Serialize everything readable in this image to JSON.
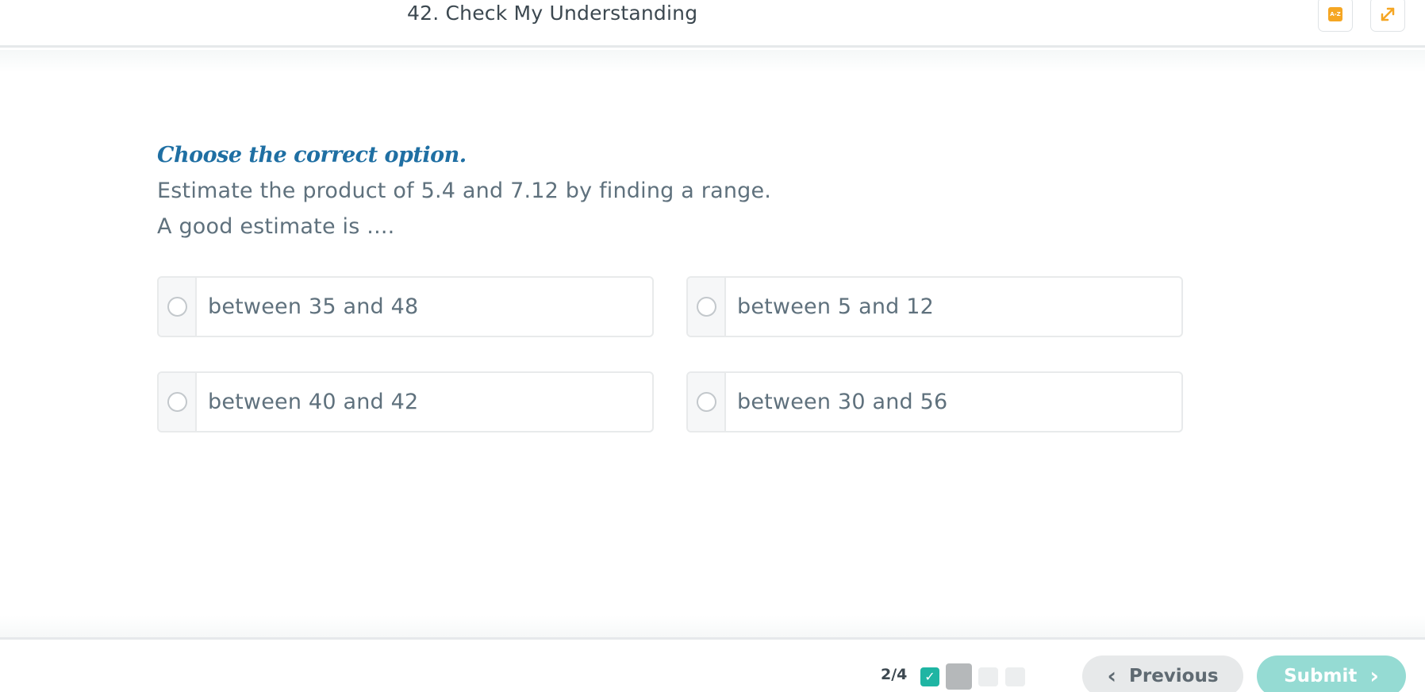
{
  "header": {
    "lesson_title": "42. Check My Understanding",
    "glossary_icon_text": "A-Z"
  },
  "question": {
    "instruction": "Choose the correct option.",
    "prompt_lines": [
      "Estimate the product of 5.4 and 7.12 by finding a range.",
      "A good estimate is ...."
    ]
  },
  "options": [
    {
      "label": "between 35 and 48",
      "selected": false
    },
    {
      "label": "between 5 and 12",
      "selected": false
    },
    {
      "label": "between 40 and 42",
      "selected": false
    },
    {
      "label": "between 30 and 56",
      "selected": false
    }
  ],
  "footer": {
    "progress_text": "2/4",
    "steps": [
      {
        "state": "completed"
      },
      {
        "state": "current"
      },
      {
        "state": "pending"
      },
      {
        "state": "pending"
      }
    ],
    "previous_label": "Previous",
    "submit_label": "Submit"
  },
  "colors": {
    "instruction": "#1f6fa3",
    "submit_disabled": "#95dbd3",
    "step_completed": "#1fb5a3",
    "glossary_icon": "#f5a623",
    "expand_icon": "#f5a623"
  }
}
